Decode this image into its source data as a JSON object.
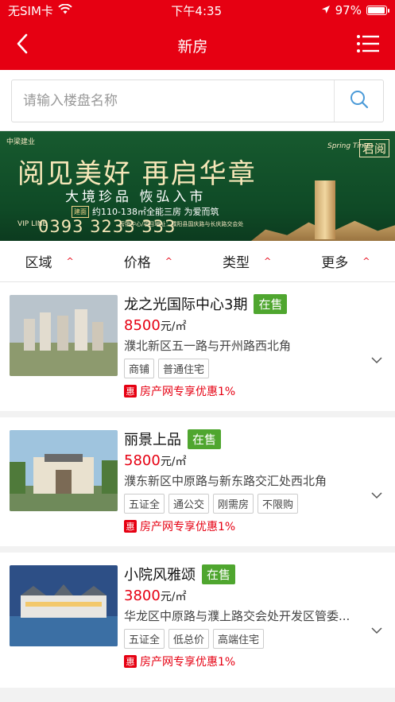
{
  "status": {
    "carrier": "无SIM卡",
    "time": "下午4:35",
    "battery": "97%",
    "battery_level": 0.97
  },
  "nav": {
    "title": "新房"
  },
  "search": {
    "placeholder": "请输入楼盘名称"
  },
  "banner": {
    "brand": "中梁建业",
    "headline": "阅见美好 再启华章",
    "sub": "大境珍品 恢弘入市",
    "spec_chip": "建面",
    "spec": "约110-138㎡全能三房 为爱而筑",
    "phone_label": "VIP LINE",
    "phone": "0393 3233 333",
    "address": "营销中心/项目地址：濮阳县国庆路与长庆路交会处",
    "logo1": "Spring Time",
    "logo2": "君阅"
  },
  "filters": [
    {
      "label": "区域"
    },
    {
      "label": "价格"
    },
    {
      "label": "类型"
    },
    {
      "label": "更多"
    }
  ],
  "listings": [
    {
      "title": "龙之光国际中心3期",
      "badge": "在售",
      "price": "8500",
      "unit": "元/㎡",
      "address": "濮北新区五一路与开州路西北角",
      "tags": [
        "商铺",
        "普通住宅"
      ],
      "promo_icon": "惠",
      "promo": "房产网专享优惠1%"
    },
    {
      "title": "丽景上品",
      "badge": "在售",
      "price": "5800",
      "unit": "元/㎡",
      "address": "濮东新区中原路与新东路交汇处西北角",
      "tags": [
        "五证全",
        "通公交",
        "刚需房",
        "不限购"
      ],
      "promo_icon": "惠",
      "promo": "房产网专享优惠1%"
    },
    {
      "title": "小院风雅颂",
      "badge": "在售",
      "price": "3800",
      "unit": "元/㎡",
      "address": "华龙区中原路与濮上路交会处开发区管委...",
      "tags": [
        "五证全",
        "低总价",
        "高端住宅"
      ],
      "promo_icon": "惠",
      "promo": "房产网专享优惠1%"
    }
  ],
  "colors": {
    "brand_red": "#e60012",
    "sale_green": "#4fa62f"
  }
}
